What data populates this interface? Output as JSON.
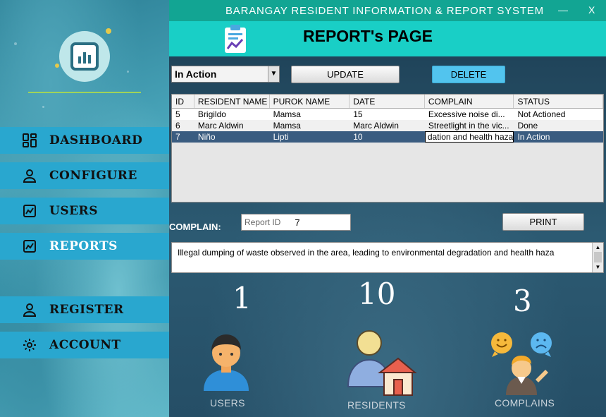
{
  "window": {
    "title": "BARANGAY RESIDENT INFORMATION & REPORT SYSTEM",
    "minimize_label": "—",
    "close_label": "X"
  },
  "header": {
    "page_title": "REPORT's PAGE"
  },
  "sidebar": {
    "items": [
      {
        "label": "DASHBOARD",
        "icon": "dashboard-icon"
      },
      {
        "label": "CONFIGURE",
        "icon": "user-icon"
      },
      {
        "label": "USERS",
        "icon": "chart-doc-icon"
      },
      {
        "label": "REPORTS",
        "icon": "chart-doc-icon",
        "active": true
      },
      {
        "label": "REGISTER",
        "icon": "user-icon"
      },
      {
        "label": "ACCOUNT",
        "icon": "gear-icon"
      }
    ]
  },
  "toolbar": {
    "status_select": "In Action",
    "update_label": "UPDATE",
    "delete_label": "DELETE"
  },
  "table": {
    "columns": [
      "ID",
      "RESIDENT NAME",
      "PUROK NAME",
      "DATE",
      "COMPLAIN",
      "STATUS"
    ],
    "rows": [
      [
        "5",
        "Brigildo",
        "Mamsa",
        "15",
        "Excessive noise di...",
        "Not Actioned"
      ],
      [
        "6",
        "Marc Aldwin",
        "Mamsa",
        "Marc Aldwin",
        " Streetlight in the vic...",
        "Done"
      ],
      [
        "7",
        "Niño",
        "Lipti",
        "10",
        "dation and health haza",
        "In Action"
      ]
    ]
  },
  "form": {
    "complain_label": "COMPLAIN:",
    "report_id_placeholder": "Report ID",
    "report_id_value": "7",
    "print_label": "PRINT",
    "complain_text": "Illegal dumping of waste observed in the area, leading to environmental degradation and health haza"
  },
  "stats": {
    "users": {
      "value": "1",
      "label": "USERS"
    },
    "residents": {
      "value": "10",
      "label": "RESIDENTS"
    },
    "complains": {
      "value": "3",
      "label": "COMPLAINS"
    }
  },
  "colors": {
    "titlebar": "#12a593",
    "header": "#19cfc6",
    "nav_item": "#29a7cf",
    "delete_button": "#52c4ee",
    "selected_row": "#3a5c80"
  }
}
